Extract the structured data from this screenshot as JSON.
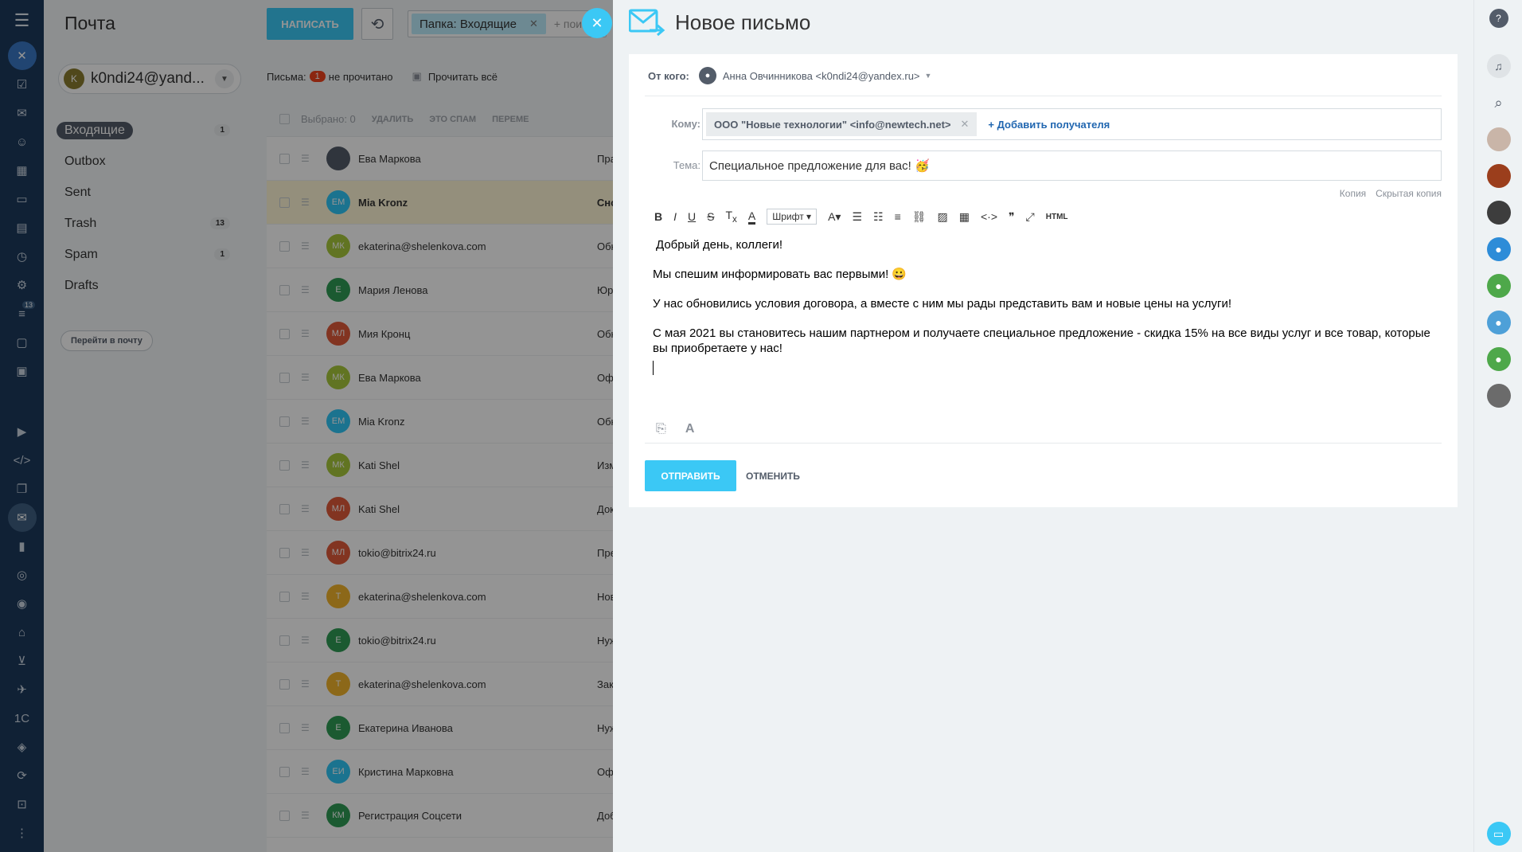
{
  "app": {
    "title": "Почта"
  },
  "toolbar": {
    "write_label": "НАПИСАТЬ",
    "folder_chip": "Папка: Входящие",
    "search_placeholder": "+ поис"
  },
  "account": {
    "initial": "K",
    "email": "k0ndi24@yand..."
  },
  "folders": [
    {
      "name": "Входящие",
      "count": "1"
    },
    {
      "name": "Outbox",
      "count": ""
    },
    {
      "name": "Sent",
      "count": ""
    },
    {
      "name": "Trash",
      "count": "13"
    },
    {
      "name": "Spam",
      "count": "1"
    },
    {
      "name": "Drafts",
      "count": ""
    }
  ],
  "goto_mail": "Перейти в почту",
  "status": {
    "letters_label": "Письма:",
    "unread_count": "1",
    "unread_label": "не прочитано",
    "read_all": "Прочитать всё"
  },
  "list_actions": {
    "selected": "Выбрано: 0",
    "delete": "УДАЛИТЬ",
    "spam": "ЭТО СПАМ",
    "move": "ПЕРЕМЕ"
  },
  "messages": [
    {
      "initials": "",
      "sender": "Ева Маркова",
      "subject": "Пра",
      "color": "#535c69"
    },
    {
      "initials": "ЕМ",
      "sender": "Mia Kronz",
      "subject": "Сно",
      "color": "#2fc6f6"
    },
    {
      "initials": "МК",
      "sender": "ekaterina@shelenkova.com",
      "subject": "Обн",
      "color": "#a8c93b"
    },
    {
      "initials": "Е",
      "sender": "Мария Ленова",
      "subject": "Юр",
      "color": "#2f9c55"
    },
    {
      "initials": "МЛ",
      "sender": "Мия Кронц",
      "subject": "Обн",
      "color": "#e05a3a"
    },
    {
      "initials": "МК",
      "sender": "Ева Маркова",
      "subject": "Оф",
      "color": "#a8c93b"
    },
    {
      "initials": "ЕМ",
      "sender": "Mia Kronz",
      "subject": "Обн",
      "color": "#2fc6f6"
    },
    {
      "initials": "МК",
      "sender": "Kati Shel",
      "subject": "Изм",
      "color": "#a8c93b"
    },
    {
      "initials": "МЛ",
      "sender": "Kati Shel",
      "subject": "Док",
      "color": "#e05a3a"
    },
    {
      "initials": "МЛ",
      "sender": "tokio@bitrix24.ru",
      "subject": "Пре",
      "color": "#e05a3a"
    },
    {
      "initials": "Т",
      "sender": "ekaterina@shelenkova.com",
      "subject": "Нов",
      "color": "#f2b42b"
    },
    {
      "initials": "Е",
      "sender": "tokio@bitrix24.ru",
      "subject": "Нуж",
      "color": "#2f9c55"
    },
    {
      "initials": "Т",
      "sender": "ekaterina@shelenkova.com",
      "subject": "Зак",
      "color": "#f2b42b"
    },
    {
      "initials": "Е",
      "sender": "Екатерина Иванова",
      "subject": "Нуж",
      "color": "#2f9c55"
    },
    {
      "initials": "ЕИ",
      "sender": "Кристина Марковна",
      "subject": "Оф",
      "color": "#2fc6f6"
    },
    {
      "initials": "КМ",
      "sender": "Регистрация Соцсети",
      "subject": "Доб",
      "color": "#2f9c55"
    }
  ],
  "compose": {
    "title": "Новое письмо",
    "from_label": "От кого:",
    "from_value": "Анна Овчинникова <k0ndi24@yandex.ru>",
    "to_label": "Кому:",
    "recipient": "ООО \"Новые технологии\" <info@newtech.net>",
    "add_recipient": "+ Добавить получателя",
    "subject_label": "Тема:",
    "subject_value": "Специальное предложение для вас! 🥳",
    "cc": "Копия",
    "bcc": "Скрытая копия",
    "font_label": "Шрифт",
    "html_label": "HTML",
    "body": [
      "Добрый день, коллеги!",
      "Мы спешим информировать вас первыми! 😀",
      "У нас обновились условия  договора, а вместе с ним мы рады представить вам и новые цены на услуги!",
      "С мая 2021 вы становитесь нашим партнером и получаете специальное предложение - скидка 15% на все виды услуг и все товар, которые вы приобретаете у нас!"
    ],
    "send_label": "ОТПРАВИТЬ",
    "cancel_label": "ОТМЕНИТЬ"
  },
  "left_nav_badge": "13",
  "colors": {
    "accent": "#3bc8f5",
    "nav": "#1d3a5c",
    "unread": "#f0421c"
  }
}
